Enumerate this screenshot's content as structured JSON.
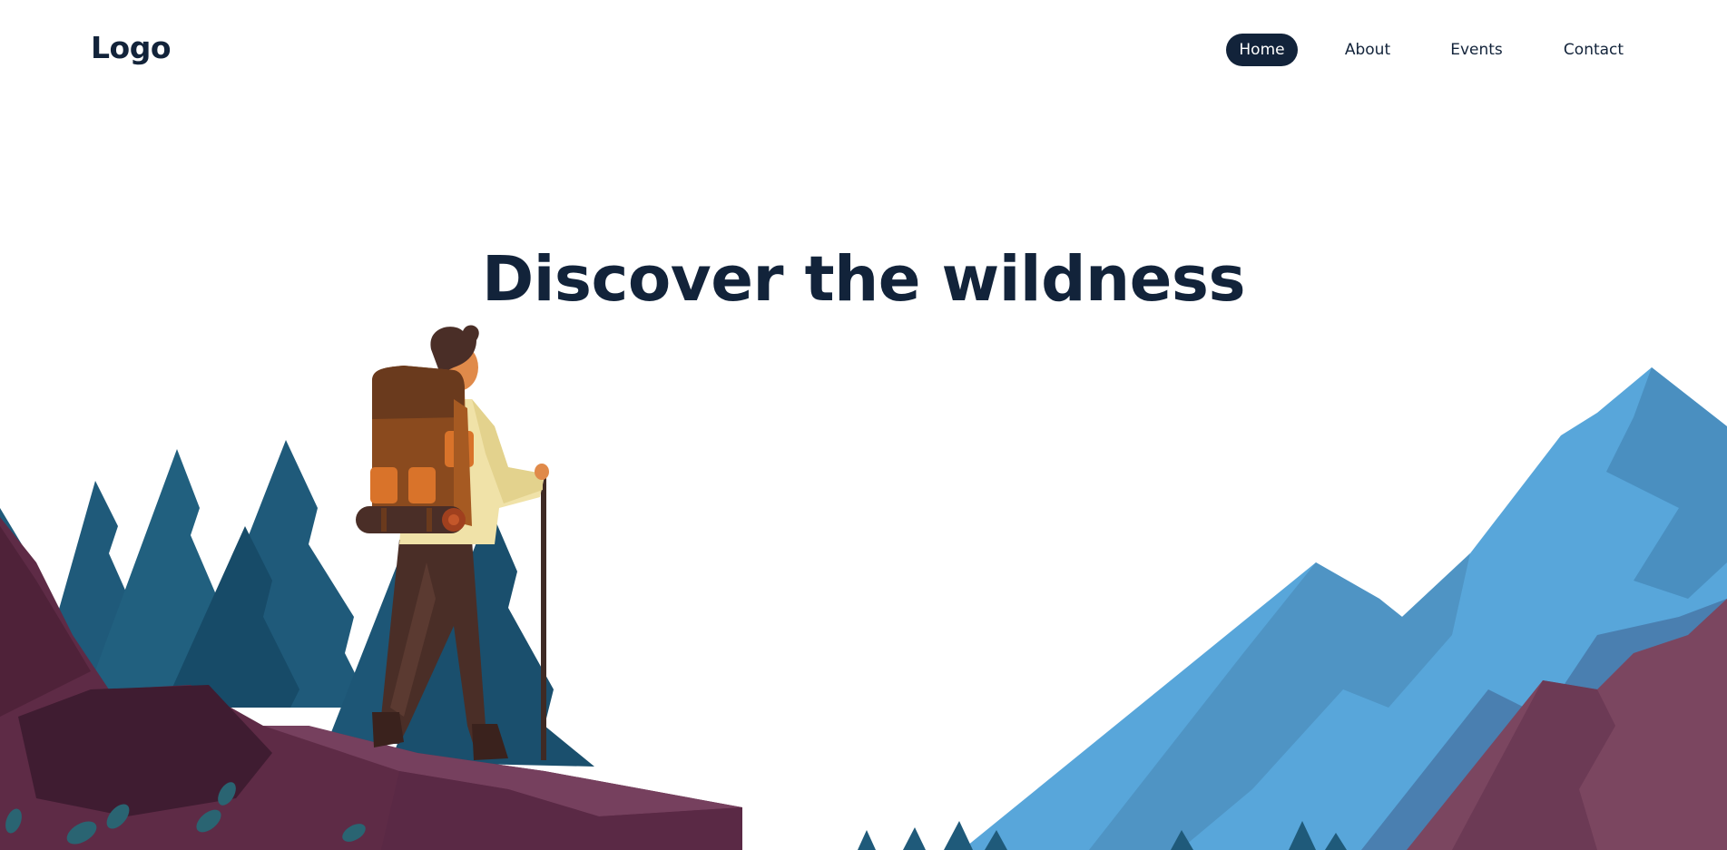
{
  "header": {
    "logo": "Logo",
    "nav": [
      {
        "label": "Home",
        "active": true
      },
      {
        "label": "About",
        "active": false
      },
      {
        "label": "Events",
        "active": false
      },
      {
        "label": "Contact",
        "active": false
      }
    ]
  },
  "hero": {
    "title": "Discover the wildness"
  },
  "colors": {
    "dark_navy": "#12233a",
    "tree_blue": "#1f5a7a",
    "mountain_blue": "#58a6da",
    "rock_purple": "#5e2b46",
    "backpack_brown": "#8a4a1e",
    "shirt_cream": "#f0e2a8"
  }
}
